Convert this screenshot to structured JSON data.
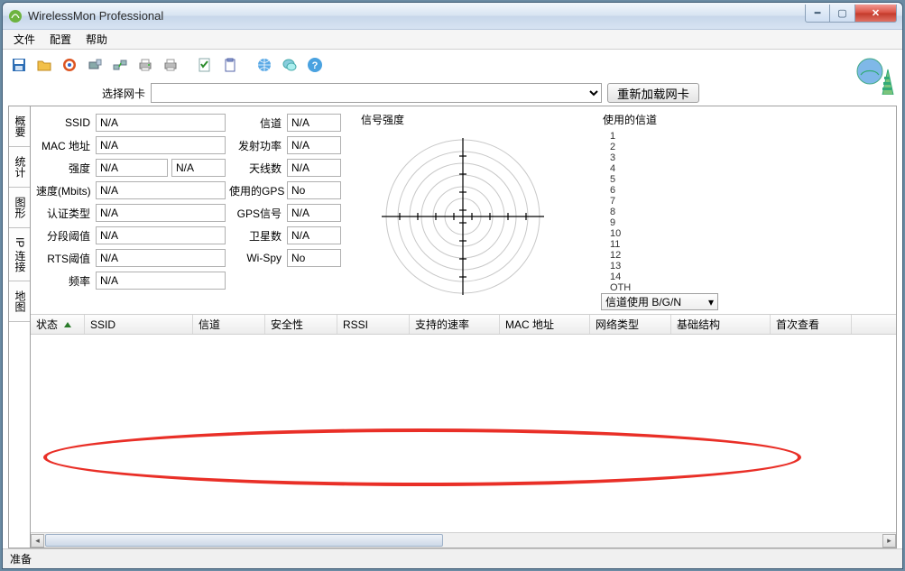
{
  "window": {
    "title": "WirelessMon Professional"
  },
  "menubar": [
    "文件",
    "配置",
    "帮助"
  ],
  "adapter": {
    "label": "选择网卡",
    "reload": "重新加载网卡"
  },
  "side_tabs": [
    "概要",
    "统计",
    "图形",
    "IP 连接",
    "地图"
  ],
  "info": {
    "ssid_lbl": "SSID",
    "ssid": "N/A",
    "mac_lbl": "MAC 地址",
    "mac": "N/A",
    "strength_lbl": "强度",
    "strength1": "N/A",
    "strength2": "N/A",
    "speed_lbl": "速度(Mbits)",
    "speed": "N/A",
    "auth_lbl": "认证类型",
    "auth": "N/A",
    "frag_lbl": "分段阈值",
    "frag": "N/A",
    "rts_lbl": "RTS阈值",
    "rts": "N/A",
    "freq_lbl": "频率",
    "freq": "N/A",
    "chan_lbl": "信道",
    "chan": "N/A",
    "txpower_lbl": "发射功率",
    "txpower": "N/A",
    "ant_lbl": "天线数",
    "ant": "N/A",
    "gps_lbl": "使用的GPS",
    "gps": "No",
    "gpssig_lbl": "GPS信号",
    "gpssig": "N/A",
    "sat_lbl": "卫星数",
    "sat": "N/A",
    "wispy_lbl": "Wi-Spy",
    "wispy": "No"
  },
  "radar_title": "信号强度",
  "channels_title": "使用的信道",
  "channel_list": [
    "1",
    "2",
    "3",
    "4",
    "5",
    "6",
    "7",
    "8",
    "9",
    "10",
    "11",
    "12",
    "13",
    "14",
    "OTH"
  ],
  "channel_combo": "信道使用 B/G/N",
  "grid_cols": [
    "状态",
    "SSID",
    "信道",
    "安全性",
    "RSSI",
    "支持的速率",
    "MAC 地址",
    "网络类型",
    "基础结构",
    "首次查看"
  ],
  "grid_col_widths": [
    60,
    120,
    80,
    80,
    80,
    100,
    100,
    90,
    110,
    90
  ],
  "status": "准备"
}
